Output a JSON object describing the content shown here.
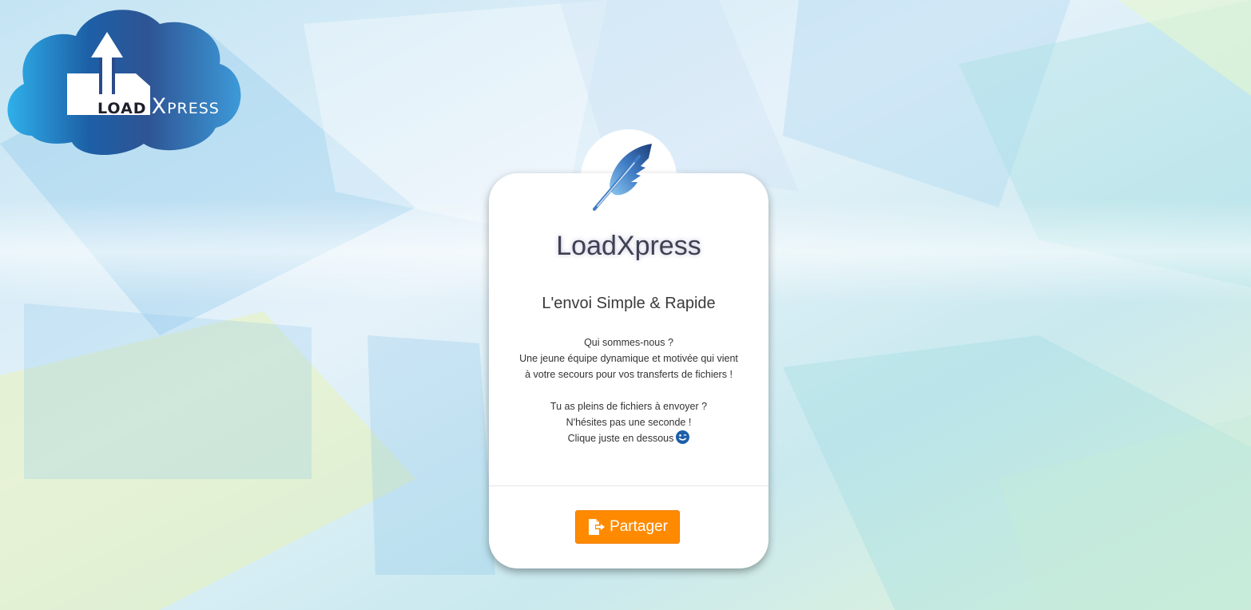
{
  "logo": {
    "part_load": "LOAD",
    "part_x": "X",
    "part_press": "PRESS",
    "icon": "cloud-upload-logo-icon"
  },
  "card": {
    "badge_icon": "feather-icon",
    "title": "LoadXpress",
    "subtitle": "L'envoi Simple & Rapide",
    "text_lines": [
      "Qui sommes-nous ?",
      "Une jeune équipe dynamique et motivée qui vient",
      "à votre secours pour vos transferts de fichiers !"
    ],
    "text_lines_2": [
      "Tu as pleins de fichiers à envoyer ?",
      "N'hésites pas une seconde !",
      "Clique juste en dessous"
    ],
    "smiley_icon": "wink-smiley-icon",
    "button": {
      "label": "Partager",
      "icon": "file-export-icon"
    }
  },
  "colors": {
    "accent_orange": "#ff8a00",
    "title_text": "#3f4152",
    "logo_blue_dark": "#2b4f8c",
    "logo_blue_light": "#3fa8e0",
    "smiley_blue": "#1c5fa8"
  }
}
